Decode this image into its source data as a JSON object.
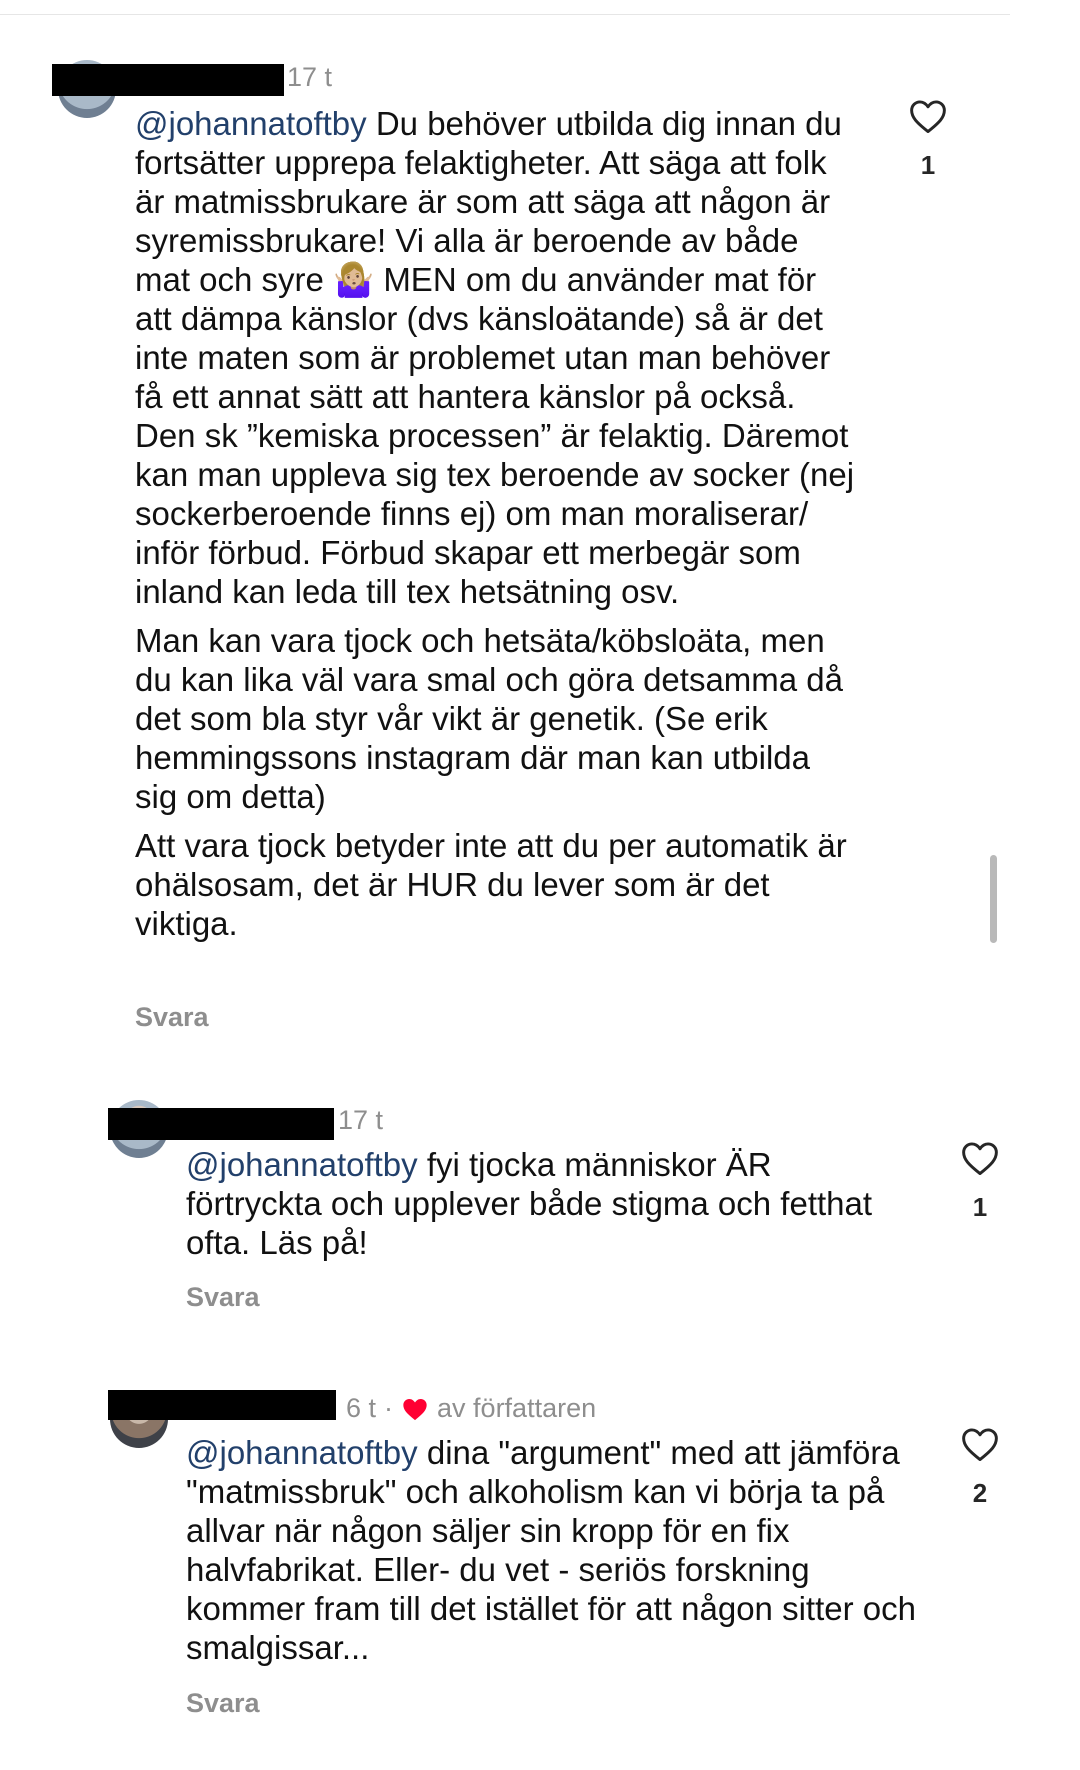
{
  "comments": [
    {
      "time": "17 t",
      "author_tag": "",
      "mention": "@johannatoftby",
      "paragraphs": [
        "Du behöver utbilda dig innan du fortsätter upprepa felaktigheter. Att säga att folk är matmissbrukare är som att säga att någon är syremissbrukare! Vi alla är beroende av både mat och syre 🤷🏼‍♀️ MEN om du använder mat för att dämpa känslor (dvs känsloätande) så är det inte maten som är problemet utan man behöver få ett annat sätt att hantera känslor på också. Den sk ”kemiska processen” är felaktig. Däremot kan man uppleva sig tex beroende av socker (nej sockerberoende finns ej) om man moraliserar/ inför förbud. Förbud skapar ett merbegär som inland kan leda till tex hetsätning osv.",
        "Man kan vara tjock och hetsäta/köbsloäta, men du kan lika väl vara smal och göra detsamma då det som bla styr vår vikt är genetik. (Se erik hemmingssons instagram där man kan utbilda sig om detta)",
        "Att vara tjock betyder inte att du per automatik är ohälsosam, det är HUR du lever som är det viktiga."
      ],
      "reply_label": "Svara",
      "like_count": "1",
      "like_icon": "heart-outline-icon"
    },
    {
      "time": "17 t",
      "author_tag": "",
      "mention": "@johannatoftby",
      "paragraphs": [
        "fyi tjocka människor ÄR förtryckta och upplever både stigma och fetthat ofta. Läs på!"
      ],
      "reply_label": "Svara",
      "like_count": "1",
      "like_icon": "heart-outline-icon"
    },
    {
      "time": "6 t",
      "separator": "·",
      "author_tag": "av författaren",
      "author_heart_color": "#ff0033",
      "mention": "@johannatoftby",
      "paragraphs": [
        "dina \"argument\" med att jämföra \"matmissbruk\" och alkoholism kan vi börja ta på allvar när någon säljer sin kropp för en fix halvfabrikat. Eller- du vet - seriös forskning kommer fram till det istället för att någon sitter och smalgissar..."
      ],
      "reply_label": "Svara",
      "like_count": "2",
      "like_icon": "heart-outline-icon"
    }
  ]
}
